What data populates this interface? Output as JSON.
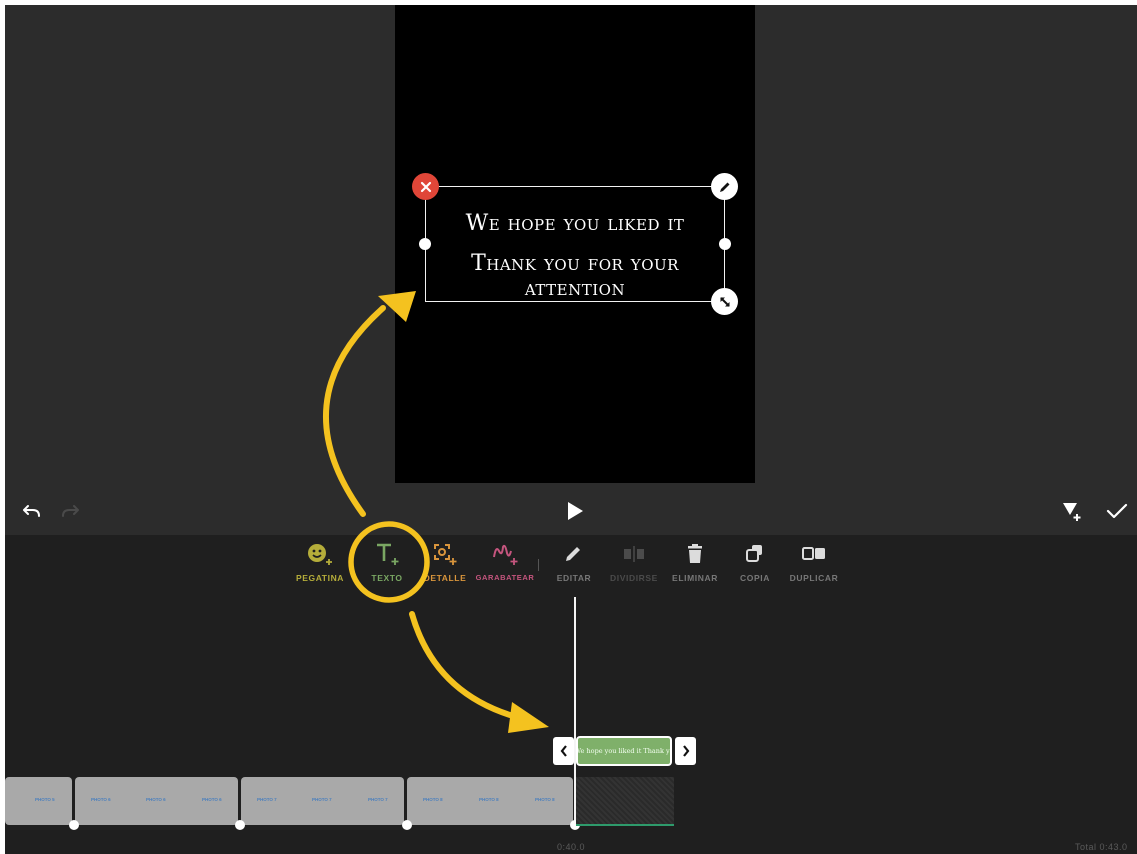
{
  "overlay": {
    "line1": "We hope you liked it",
    "line2": "Thank you for your attention"
  },
  "tools": [
    {
      "label": "PEGATINA",
      "icon": "sticker-add-icon",
      "color": "#b5ad3a"
    },
    {
      "label": "TEXTO",
      "icon": "text-add-icon",
      "color": "#7aa763"
    },
    {
      "label": "DETALLE",
      "icon": "detail-add-icon",
      "color": "#d9953c"
    },
    {
      "label": "GARABATEAR",
      "icon": "doodle-add-icon",
      "color": "#c5557e"
    },
    {
      "label": "EDITAR",
      "icon": "pencil-icon",
      "color": "#777777"
    },
    {
      "label": "DIVIDIRSE",
      "icon": "split-icon",
      "color": "#4b4b4b"
    },
    {
      "label": "ELIMINAR",
      "icon": "trash-icon",
      "color": "#777777"
    },
    {
      "label": "COPIA",
      "icon": "copy-icon",
      "color": "#777777"
    },
    {
      "label": "DUPLICAR",
      "icon": "duplicate-icon",
      "color": "#777777"
    }
  ],
  "timeline": {
    "text_clip_label": "We hope you liked it Thank yo",
    "photo_labels": [
      "PHOTO 5",
      "PHOTO 6",
      "PHOTO 6",
      "PHOTO 6",
      "PHOTO 7",
      "PHOTO 7",
      "PHOTO 7",
      "PHOTO 8",
      "PHOTO 8",
      "PHOTO 8"
    ],
    "current_time": "0:40.0",
    "total_time": "Total 0:43.0"
  },
  "colors": {
    "annotation_yellow": "#f4c21f",
    "delete_red": "#e04638",
    "audio_green": "#2e9a6b"
  }
}
